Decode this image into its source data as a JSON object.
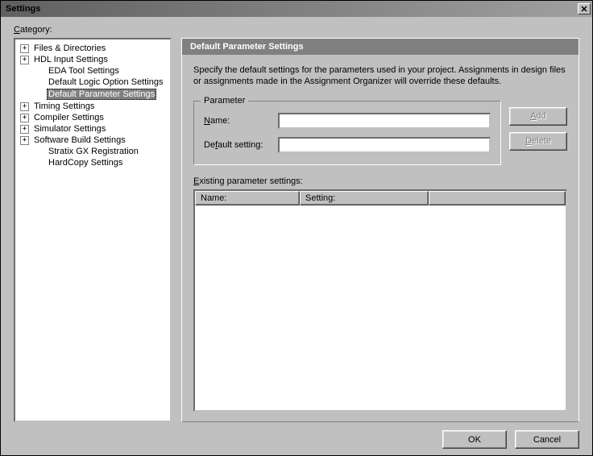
{
  "window": {
    "title": "Settings"
  },
  "category_label": "Category:",
  "tree": [
    {
      "label": "Files & Directories",
      "depth": 1,
      "exp": "+",
      "selected": false
    },
    {
      "label": "HDL Input Settings",
      "depth": 1,
      "exp": "+",
      "selected": false
    },
    {
      "label": "EDA Tool Settings",
      "depth": 2,
      "exp": "",
      "selected": false
    },
    {
      "label": "Default Logic Option Settings",
      "depth": 2,
      "exp": "",
      "selected": false
    },
    {
      "label": "Default Parameter Settings",
      "depth": 2,
      "exp": "",
      "selected": true
    },
    {
      "label": "Timing Settings",
      "depth": 1,
      "exp": "+",
      "selected": false
    },
    {
      "label": "Compiler Settings",
      "depth": 1,
      "exp": "+",
      "selected": false
    },
    {
      "label": "Simulator Settings",
      "depth": 1,
      "exp": "+",
      "selected": false
    },
    {
      "label": "Software Build Settings",
      "depth": 1,
      "exp": "+",
      "selected": false
    },
    {
      "label": "Stratix GX Registration",
      "depth": 2,
      "exp": "",
      "selected": false
    },
    {
      "label": "HardCopy Settings",
      "depth": 2,
      "exp": "",
      "selected": false
    }
  ],
  "panel": {
    "title": "Default Parameter Settings",
    "description": "Specify the default settings for the parameters used in your project.  Assignments in design files or assignments made in the Assignment Organizer will override these defaults.",
    "fieldset_legend": "Parameter",
    "name_label": "Name:",
    "name_value": "",
    "default_label": "Default setting:",
    "default_value": "",
    "add_label": "Add",
    "delete_label": "Delete",
    "existing_label": "Existing parameter settings:",
    "columns": {
      "name": "Name:",
      "setting": "Setting:"
    }
  },
  "footer": {
    "ok": "OK",
    "cancel": "Cancel"
  }
}
